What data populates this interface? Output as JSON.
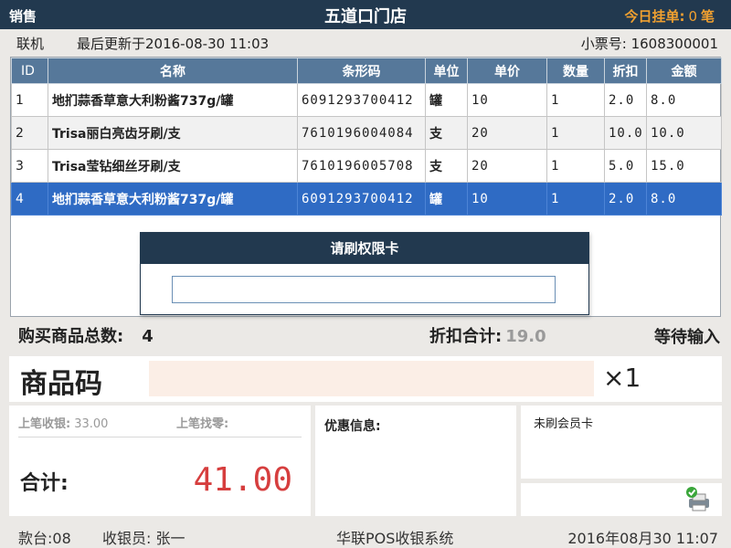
{
  "header": {
    "mode": "销售",
    "store_name": "五道口门店",
    "pending_label": "今日挂单:",
    "pending_count": "0",
    "pending_unit": "笔"
  },
  "info": {
    "connection": "联机",
    "last_updated": "最后更新于2016-08-30 11:03",
    "ticket_label": "小票号:",
    "ticket_no": "1608300001"
  },
  "table": {
    "columns": [
      "ID",
      "名称",
      "条形码",
      "单位",
      "单价",
      "数量",
      "折扣",
      "金额"
    ],
    "rows": [
      {
        "id": "1",
        "name": "地扪蒜香草意大利粉酱737g/罐",
        "barcode": "6091293700412",
        "unit": "罐",
        "price": "10",
        "qty": "1",
        "discount": "2.0",
        "amount": "8.0"
      },
      {
        "id": "2",
        "name": "Trisa丽白亮齿牙刷/支",
        "barcode": "7610196004084",
        "unit": "支",
        "price": "20",
        "qty": "1",
        "discount": "10.0",
        "amount": "10.0"
      },
      {
        "id": "3",
        "name": "Trisa莹钻细丝牙刷/支",
        "barcode": "7610196005708",
        "unit": "支",
        "price": "20",
        "qty": "1",
        "discount": "5.0",
        "amount": "15.0"
      },
      {
        "id": "4",
        "name": "地扪蒜香草意大利粉酱737g/罐",
        "barcode": "6091293700412",
        "unit": "罐",
        "price": "10",
        "qty": "1",
        "discount": "2.0",
        "amount": "8.0"
      }
    ],
    "selected_row": 4
  },
  "dialog": {
    "title": "请刷权限卡",
    "input_value": ""
  },
  "summary": {
    "total_items_label": "购买商品总数:",
    "total_items": "4",
    "discount_label": "折扣合计:",
    "discount_total": "19.0",
    "status": "等待输入"
  },
  "code_bar": {
    "label": "商品码",
    "input_value": "",
    "quantity": "×1"
  },
  "totals": {
    "last_received_label": "上笔收银:",
    "last_received": "33.00",
    "last_change_label": "上笔找零:",
    "last_change": "",
    "total_label": "合计:",
    "total_value": "41.00"
  },
  "promo": {
    "label": "优惠信息:"
  },
  "member": {
    "label": "未刷会员卡"
  },
  "printer": {
    "icon": "printer-ok-icon"
  },
  "footer": {
    "terminal": "款台:08",
    "cashier": "收银员: 张一",
    "system_name": "华联POS收银系统",
    "datetime": "2016年08月30 11:07"
  },
  "colors": {
    "title_bg": "#22394f",
    "table_header_bg": "#56789a",
    "selected_row_bg": "#2f6bc4",
    "pending_accent": "#f0a030",
    "total_red": "#d63e3e",
    "code_input_bg": "#fbeee6"
  }
}
